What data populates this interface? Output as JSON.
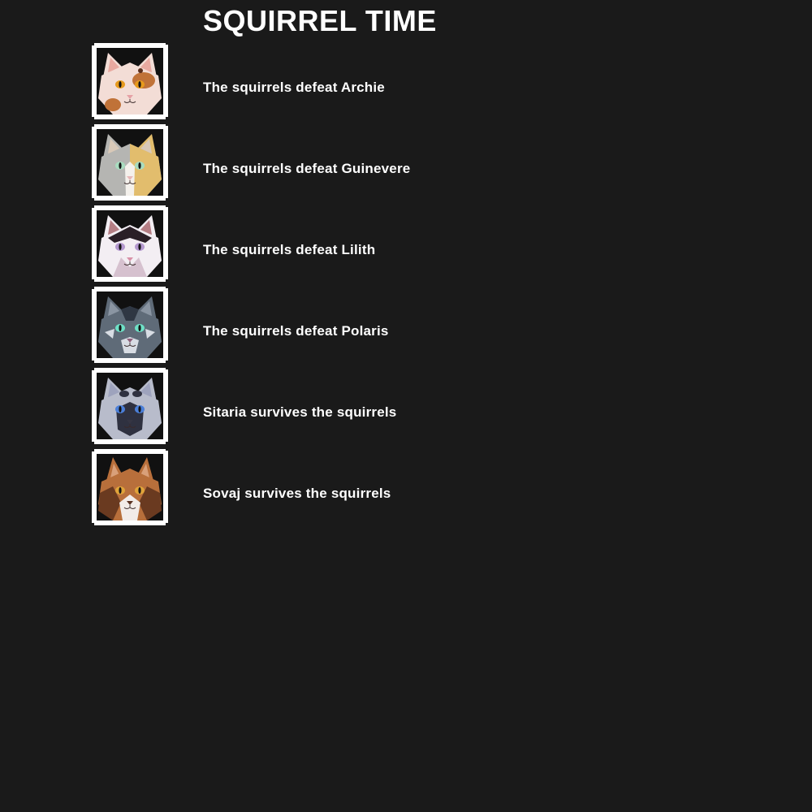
{
  "page": {
    "title": "SQUIRREL TIME",
    "background": "#1a1a1a",
    "text_color": "#ffffff"
  },
  "events": [
    {
      "text": "The squirrels defeat Archie",
      "portrait": {
        "icon": "cat-portrait-icon",
        "bg": "#111111",
        "fur": "#f3ddd6",
        "patch": "#c07238",
        "patch2": "#5a2e1c",
        "ear": "#e8a9a0",
        "eye": "#e79a1c",
        "nose": "#e6a1a5",
        "variant": "calico"
      }
    },
    {
      "text": "The squirrels defeat Guinevere",
      "portrait": {
        "icon": "cat-portrait-icon",
        "bg": "#111111",
        "fur": "#b5b5b2",
        "patch": "#e2bd6d",
        "patch2": "#f4f1ec",
        "ear": "#d9c9b8",
        "eye": "#a8dcbf",
        "nose": "#e7b8b8",
        "variant": "split"
      }
    },
    {
      "text": "The squirrels defeat Lilith",
      "portrait": {
        "icon": "cat-portrait-icon",
        "bg": "#111111",
        "fur": "#f3eef3",
        "patch": "#2a1f26",
        "patch2": "#d6c1cf",
        "ear": "#b57e84",
        "eye": "#b498cf",
        "nose": "#d891a8",
        "variant": "capped"
      }
    },
    {
      "text": "The squirrels defeat Polaris",
      "portrait": {
        "icon": "cat-portrait-icon",
        "bg": "#111111",
        "fur": "#5f6b78",
        "patch": "#2f3743",
        "patch2": "#d8dde4",
        "ear": "#8a95a2",
        "eye": "#6ee0c6",
        "nose": "#8e5f7a",
        "variant": "tabby"
      }
    },
    {
      "text": "Sitaria survives the squirrels",
      "portrait": {
        "icon": "cat-portrait-icon",
        "bg": "#111111",
        "fur": "#b8bccb",
        "patch": "#2f3140",
        "patch2": "#d9dbe6",
        "ear": "#9ea3bd",
        "eye": "#4b7fd8",
        "nose": "#353543",
        "variant": "masked"
      }
    },
    {
      "text": "Sovaj survives the squirrels",
      "portrait": {
        "icon": "cat-portrait-icon",
        "bg": "#111111",
        "fur": "#b86f3b",
        "patch": "#6a3a20",
        "patch2": "#f2ece9",
        "ear": "#d9a07a",
        "eye": "#e0a43a",
        "nose": "#5a3324",
        "variant": "lynx"
      }
    }
  ]
}
